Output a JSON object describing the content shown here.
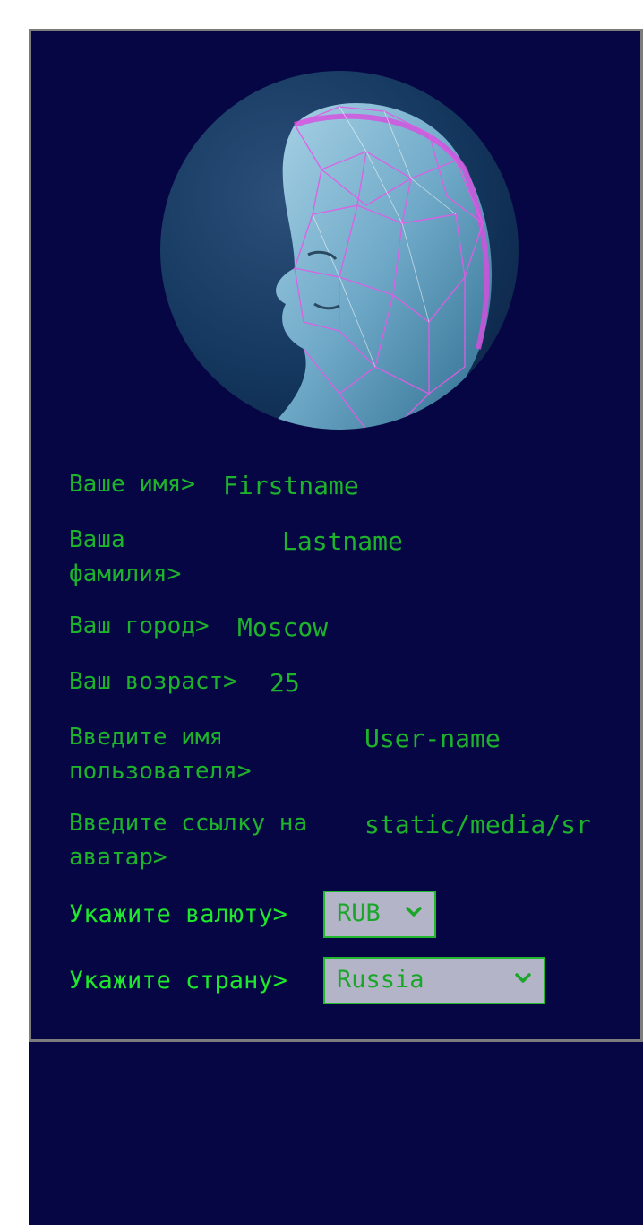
{
  "profile": {
    "fields": [
      {
        "label": "Ваше имя>",
        "value": "Firstname"
      },
      {
        "label": "Ваша фамилия>",
        "value": "Lastname"
      },
      {
        "label": "Ваш город>",
        "value": "Moscow"
      },
      {
        "label": "Ваш возраст>",
        "value": "25"
      },
      {
        "label": "Введите имя пользователя>",
        "value": "User-name"
      },
      {
        "label": "Введите ссылку на аватар>",
        "value": "static/media/sr"
      }
    ],
    "currency": {
      "label": "Укажите валюту>",
      "selected": "RUB"
    },
    "country": {
      "label": "Укажите страну>",
      "selected": "Russia"
    }
  },
  "colors": {
    "background": "#070645",
    "text_green": "#1db32b",
    "select_bg": "#b3b4c8",
    "border_gray": "#7c7c7c"
  },
  "icons": {
    "avatar": "avatar-image",
    "dropdown": "chevron-down-icon"
  }
}
